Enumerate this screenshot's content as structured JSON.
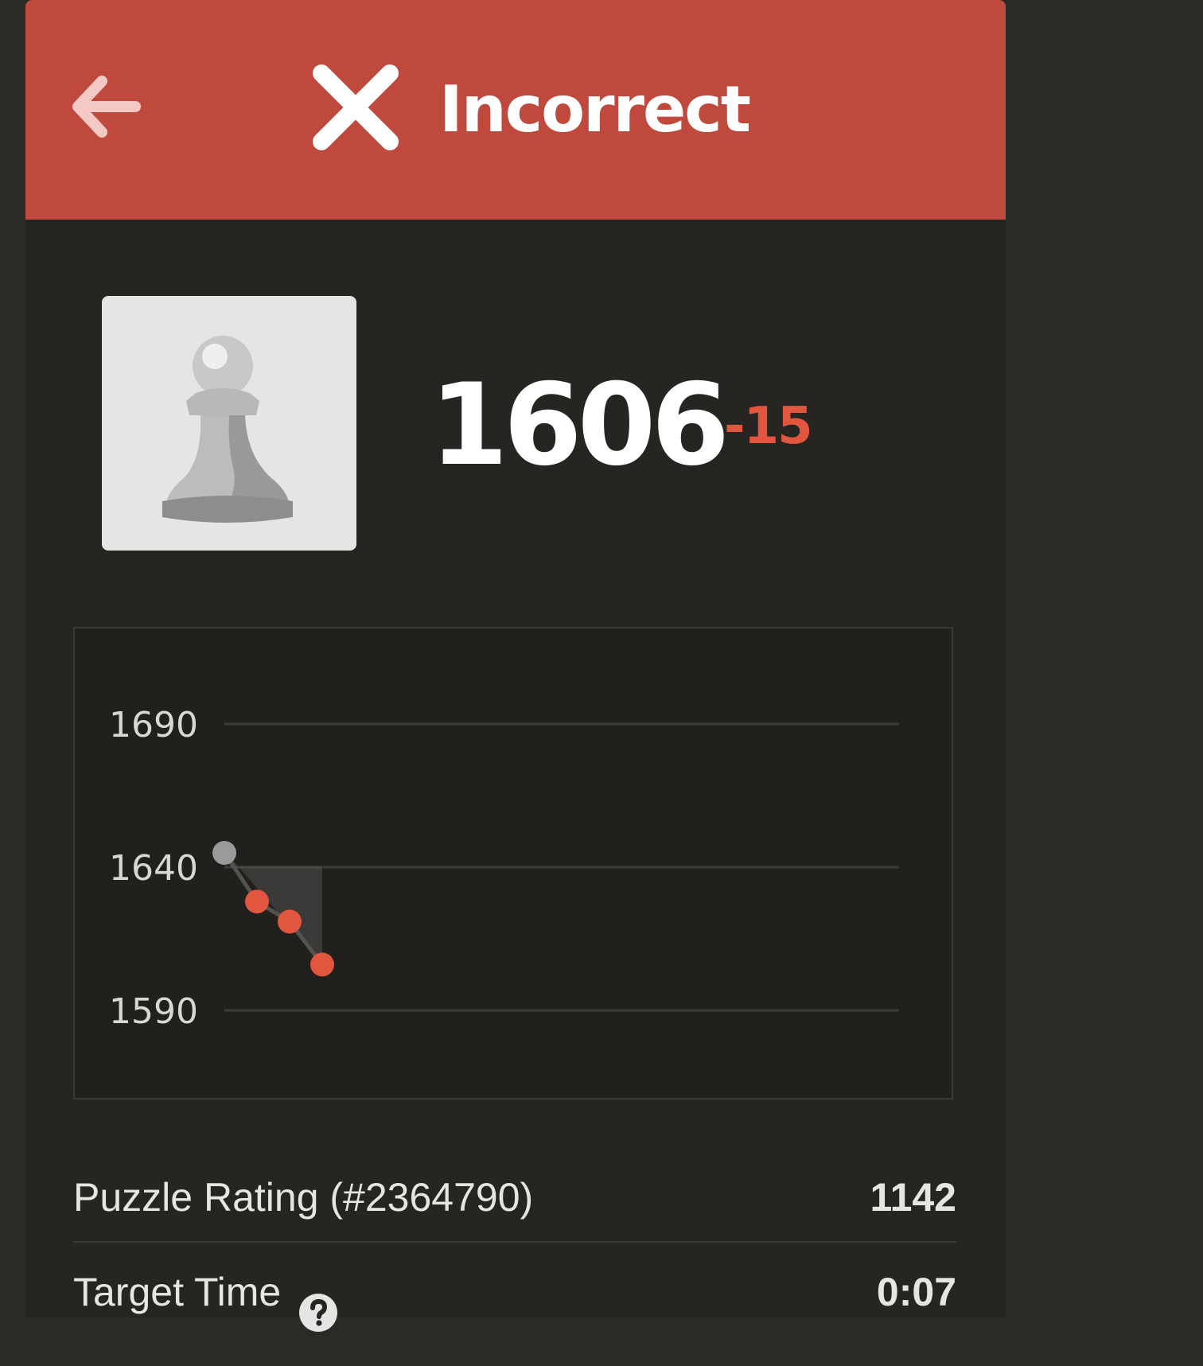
{
  "header": {
    "title": "Incorrect",
    "back_icon": "arrow-left-icon",
    "status_icon": "x-icon",
    "background_color": "#c0493e"
  },
  "rating": {
    "value": "1606",
    "change": "-15",
    "change_color": "#e2553f",
    "avatar_icon": "pawn-icon"
  },
  "chart_data": {
    "type": "line",
    "title": "",
    "xlabel": "",
    "ylabel": "",
    "yticks": [
      "1690",
      "1640",
      "1590"
    ],
    "ylim": [
      1590,
      1690
    ],
    "grid": true,
    "series": [
      {
        "x": [
          0,
          1,
          2,
          3
        ],
        "values": [
          1645,
          1628,
          1621,
          1606
        ],
        "point_colors": [
          "#9a9a9a",
          "#e2553f",
          "#e2553f",
          "#e2553f"
        ]
      }
    ],
    "baseline": 1640
  },
  "stats": {
    "puzzle_rating_label": "Puzzle Rating (#2364790)",
    "puzzle_rating_value": "1142",
    "target_time_label": "Target Time",
    "target_time_value": "0:07",
    "help_icon": "question-circle-icon"
  }
}
